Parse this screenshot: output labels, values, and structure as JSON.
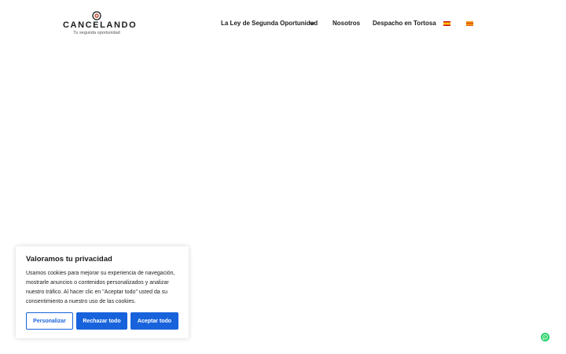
{
  "header": {
    "logo": {
      "brand": "CANCELANDO",
      "tagline": "Tu segunda oportunidad"
    },
    "nav": [
      {
        "label": "La Ley de Segunda Oportunidad",
        "has_dropdown": true
      },
      {
        "label": "Nosotros"
      },
      {
        "label": "Despacho en Tortosa"
      }
    ],
    "languages": [
      {
        "icon": "spanish-flag-icon",
        "colors": [
          "#c60b1e",
          "#ffc400"
        ]
      },
      {
        "icon": "catalan-flag-icon",
        "colors": [
          "#fcdd09",
          "#da121a"
        ]
      }
    ]
  },
  "cookie_banner": {
    "title": "Valoramos tu privacidad",
    "text": "Usamos cookies para mejorar su experiencia de navegación, mostrarle anuncios o contenidos personalizados y analizar nuestro tráfico. Al hacer clic en \"Aceptar todo\" usted da su consentimiento a nuestro uso de las cookies.",
    "buttons": {
      "customize": "Personalizar",
      "reject": "Rechazar todo",
      "accept": "Aceptar todo"
    },
    "accent_color": "#1863dc"
  },
  "floating": {
    "icon": "whatsapp-icon",
    "color": "#25d366"
  }
}
